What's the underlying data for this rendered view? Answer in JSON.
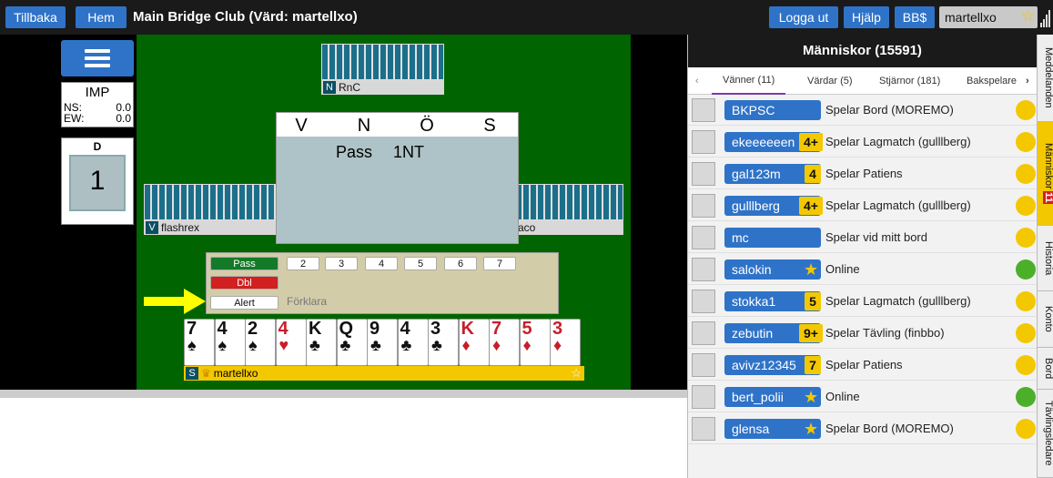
{
  "topbar": {
    "back_label": "Tillbaka",
    "home_label": "Hem",
    "title": "Main Bridge Club (Värd: martellxo)",
    "logout_label": "Logga ut",
    "help_label": "Hjälp",
    "bbdollar_label": "BB$",
    "username": "martellxo",
    "accent_color": "#2f73c8"
  },
  "score": {
    "scoring": "IMP",
    "ns_label": "NS:",
    "ns_value": "0.0",
    "ew_label": "EW:",
    "ew_value": "0.0",
    "dealer": "D",
    "board_number": "1"
  },
  "table": {
    "north": {
      "seat": "N",
      "name": "RnC"
    },
    "west": {
      "seat": "V",
      "name": "flashrex"
    },
    "east": {
      "seat": "Ö",
      "name": "aco"
    },
    "south": {
      "seat": "S",
      "name": "martellxo"
    },
    "bid_headers": [
      "V",
      "N",
      "Ö",
      "S"
    ],
    "bids": [
      "Pass",
      "1NT"
    ]
  },
  "bidding_box": {
    "pass_label": "Pass",
    "dbl_label": "Dbl",
    "alert_label": "Alert",
    "explain_placeholder": "Förklara",
    "levels": [
      "2",
      "3",
      "4",
      "5",
      "6",
      "7"
    ]
  },
  "hand": [
    {
      "rank": "7",
      "suit": "♠",
      "color": "black"
    },
    {
      "rank": "4",
      "suit": "♠",
      "color": "black"
    },
    {
      "rank": "2",
      "suit": "♠",
      "color": "black"
    },
    {
      "rank": "4",
      "suit": "♥",
      "color": "red"
    },
    {
      "rank": "K",
      "suit": "♣",
      "color": "black"
    },
    {
      "rank": "Q",
      "suit": "♣",
      "color": "black"
    },
    {
      "rank": "9",
      "suit": "♣",
      "color": "black"
    },
    {
      "rank": "4",
      "suit": "♣",
      "color": "black"
    },
    {
      "rank": "3",
      "suit": "♣",
      "color": "black"
    },
    {
      "rank": "K",
      "suit": "♦",
      "color": "red"
    },
    {
      "rank": "7",
      "suit": "♦",
      "color": "red"
    },
    {
      "rank": "5",
      "suit": "♦",
      "color": "red"
    },
    {
      "rank": "3",
      "suit": "♦",
      "color": "red"
    }
  ],
  "people": {
    "header": "Människor (15591)",
    "tabs": [
      "Vänner (11)",
      "Värdar (5)",
      "Stjärnor (181)",
      "Bakspelare"
    ],
    "rows": [
      {
        "name": "BKPSC",
        "badge": "",
        "status": "Spelar Bord (MOREMO)",
        "status_color": "#f3c800"
      },
      {
        "name": "ekeeeeeen",
        "badge": "4+",
        "status": "Spelar Lagmatch (gulllberg)",
        "status_color": "#f3c800"
      },
      {
        "name": "gal123m",
        "badge": "4",
        "status": "Spelar Patiens",
        "status_color": "#f3c800"
      },
      {
        "name": "gulllberg",
        "badge": "4+",
        "status": "Spelar Lagmatch (gulllberg)",
        "status_color": "#f3c800"
      },
      {
        "name": "mc",
        "badge": "",
        "status": "Spelar vid mitt bord",
        "status_color": "#f3c800"
      },
      {
        "name": "salokin",
        "badge": "star",
        "status": "Online",
        "status_color": "#4caf2a"
      },
      {
        "name": "stokka1",
        "badge": "5",
        "status": "Spelar Lagmatch (gulllberg)",
        "status_color": "#f3c800"
      },
      {
        "name": "zebutin",
        "badge": "9+",
        "status": "Spelar Tävling (finbbo)",
        "status_color": "#f3c800"
      },
      {
        "name": "avivz12345",
        "badge": "7",
        "status": "Spelar Patiens",
        "status_color": "#f3c800"
      },
      {
        "name": "bert_polii",
        "badge": "star",
        "status": "Online",
        "status_color": "#4caf2a"
      },
      {
        "name": "glensa",
        "badge": "star",
        "status": "Spelar Bord (MOREMO)",
        "status_color": "#f3c800"
      }
    ]
  },
  "side_tabs": {
    "messages": "Meddelanden",
    "people": "Människor",
    "people_count": "11",
    "history": "Historia",
    "account": "Konto",
    "table": "Bord",
    "tournament_director": "Tävlingsledare"
  }
}
